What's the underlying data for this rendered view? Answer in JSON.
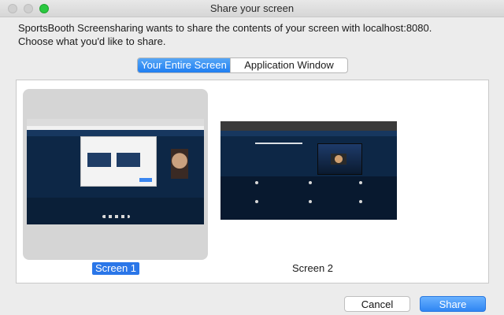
{
  "window": {
    "title": "Share your screen"
  },
  "message": {
    "line1": "SportsBooth Screensharing wants to share the contents of your screen with localhost:8080.",
    "line2": "Choose what you'd like to share."
  },
  "tabs": [
    {
      "label": "Your Entire Screen",
      "active": true
    },
    {
      "label": "Application Window",
      "active": false
    }
  ],
  "screens": [
    {
      "label": "Screen 1",
      "selected": true
    },
    {
      "label": "Screen 2",
      "selected": false
    }
  ],
  "buttons": {
    "cancel": "Cancel",
    "share": "Share"
  },
  "colors": {
    "accent": "#2a76e8",
    "selection_bg": "#d5d5d5",
    "zoom_green": "#2ac840"
  }
}
